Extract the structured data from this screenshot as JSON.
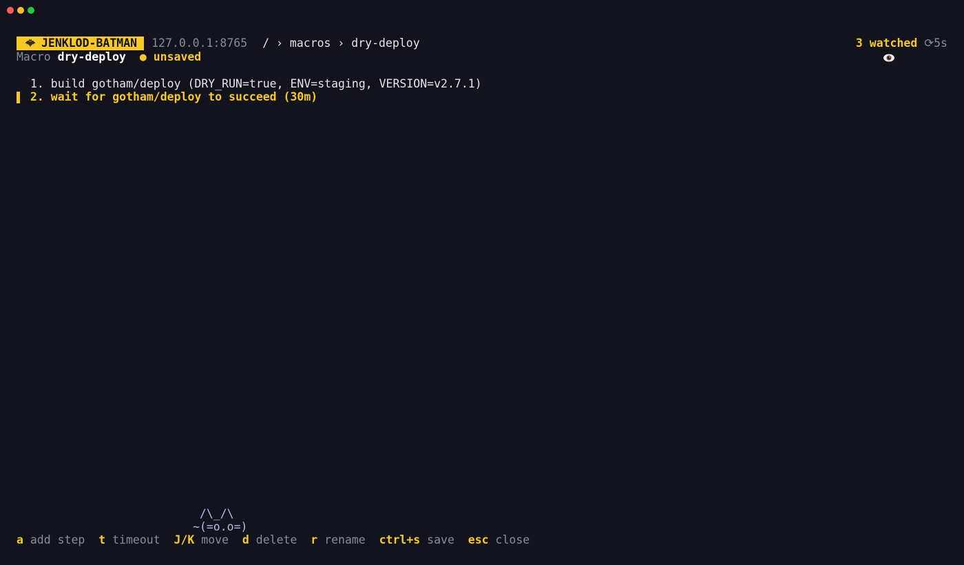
{
  "window": {
    "controls": [
      "close",
      "minimize",
      "maximize"
    ]
  },
  "header": {
    "brand": "JENKLOD-BATMAN",
    "brand_icon": "bat-icon",
    "host": "127.0.0.1:8765",
    "breadcrumb": "/ › macros › dry-deploy",
    "watched": "3 watched",
    "watched_icon": "eye-icon",
    "refresh": "⟳5s"
  },
  "macro": {
    "label": "Macro",
    "name": "dry-deploy",
    "status_dot": "●",
    "status": "unsaved"
  },
  "steps": [
    {
      "text": "1. build gotham/deploy (DRY_RUN=true, ENV=staging, VERSION=v2.7.1)"
    },
    {
      "text": "2. wait for gotham/deploy to succeed (30m)"
    }
  ],
  "mascot": {
    "line1": " /\\_/\\",
    "line2": "~(=o.o=)"
  },
  "shortcuts": [
    {
      "key": "a",
      "label": "add step"
    },
    {
      "key": "t",
      "label": "timeout"
    },
    {
      "key": "J/K",
      "label": "move"
    },
    {
      "key": "d",
      "label": "delete"
    },
    {
      "key": "r",
      "label": "rename"
    },
    {
      "key": "ctrl+s",
      "label": "save"
    },
    {
      "key": "esc",
      "label": "close"
    }
  ],
  "colors": {
    "background": "#13131d",
    "accent": "#f7c923",
    "muted": "#8b8b99",
    "mascot": "#b9b6f2"
  }
}
